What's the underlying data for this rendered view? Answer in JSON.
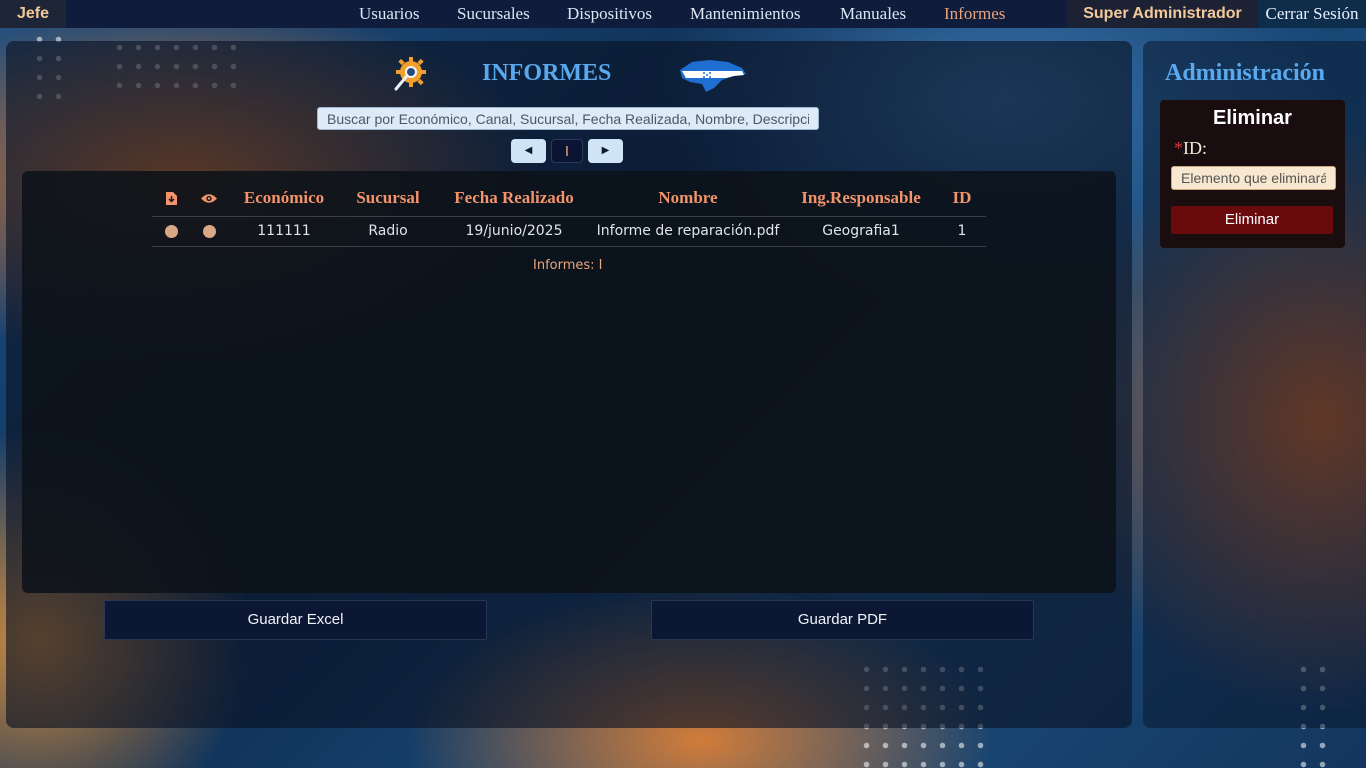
{
  "navbar": {
    "brand": "Jefe",
    "links": [
      "Usuarios",
      "Sucursales",
      "Dispositivos",
      "Mantenimientos",
      "Manuales",
      "Informes"
    ],
    "active_link": "Informes",
    "user": "Super Administrador",
    "logout": "Cerrar Sesión"
  },
  "main": {
    "title": "INFORMES",
    "title_icon": "gear-magnifier-icon",
    "flag_icon": "honduras-map-flag-icon",
    "search_placeholder": "Buscar por Económico, Canal, Sucursal, Fecha Realizada, Nombre, Descripción",
    "pager": {
      "prev_icon": "triangle-left-icon",
      "current_page": "I",
      "next_icon": "triangle-right-icon"
    },
    "table": {
      "header_icons": [
        "download-icon",
        "eye-icon"
      ],
      "columns": [
        "Económico",
        "Sucursal",
        "Fecha Realizado",
        "Nombre",
        "Ing.Responsable",
        "ID"
      ],
      "rows": [
        {
          "economico": "111111",
          "sucursal": "Radio",
          "fecha": "19/junio/2025",
          "nombre": "Informe de reparación.pdf",
          "responsable": "Geografia1",
          "id": "1"
        }
      ]
    },
    "count_label": "Informes: I",
    "save_excel": "Guardar Excel",
    "save_pdf": "Guardar PDF"
  },
  "admin": {
    "title": "Administración",
    "delete_title": "Eliminar",
    "required_mark": "*",
    "id_label": "ID:",
    "id_placeholder": "Elemento que eliminará",
    "delete_button": "Eliminar"
  },
  "colors": {
    "accent_blue": "#5aa9ee",
    "accent_salmon": "#f2936a",
    "navbar_bg": "#101c3b",
    "danger": "#6a0a0c"
  }
}
